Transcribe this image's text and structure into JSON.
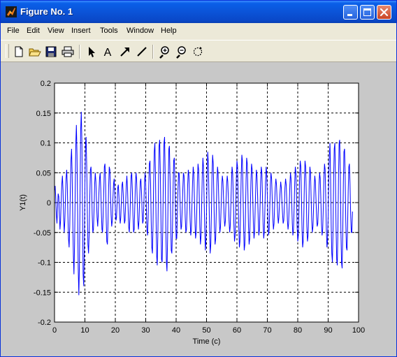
{
  "window": {
    "title": "Figure No. 1",
    "icon": "matlab-logo-icon",
    "controls": [
      "minimize-icon",
      "maximize-icon",
      "close-icon"
    ]
  },
  "menu": {
    "items": [
      "File",
      "Edit",
      "View",
      "Insert",
      "Tools",
      "Window",
      "Help"
    ]
  },
  "toolbar": {
    "tools": [
      "new-file-icon",
      "open-folder-icon",
      "save-icon",
      "print-icon",
      "select-arrow-icon",
      "insert-text-icon",
      "insert-arrow-icon",
      "insert-line-icon",
      "zoom-in-icon",
      "zoom-out-icon",
      "rotate-icon"
    ],
    "text_tool_label": "A"
  },
  "colors": {
    "titlebar": "#0a54d8",
    "figure_background": "#c8c8c8",
    "axes_background": "#ffffff",
    "series": "#0000ff"
  },
  "chart_data": {
    "type": "line",
    "xlabel": "Time (c)",
    "ylabel": "Y1(t)",
    "xlim": [
      0,
      100
    ],
    "ylim": [
      -0.2,
      0.2
    ],
    "xticks": [
      "0",
      "10",
      "20",
      "30",
      "40",
      "50",
      "60",
      "70",
      "80",
      "90",
      "100"
    ],
    "yticks": [
      "0.2",
      "0.15",
      "0.1",
      "0.05",
      "0",
      "-0.05",
      "-0.1",
      "-0.15",
      "-0.2"
    ],
    "grid": "dashed",
    "series": [
      {
        "color": "#0000ff",
        "sample_interval": 0.2,
        "x_start": 0,
        "values": [
          0.02,
          0.028,
          0.01,
          -0.02,
          -0.035,
          -0.01,
          0.015,
          0.01,
          -0.02,
          -0.045,
          -0.03,
          0.005,
          0.03,
          0.045,
          0.02,
          -0.025,
          -0.05,
          -0.03,
          0.01,
          0.04,
          0.055,
          0.03,
          -0.02,
          -0.06,
          -0.075,
          -0.04,
          0.02,
          0.07,
          0.09,
          0.05,
          -0.03,
          -0.09,
          -0.12,
          -0.07,
          0.02,
          0.1,
          0.13,
          0.08,
          -0.02,
          -0.11,
          -0.155,
          -0.1,
          0.01,
          0.12,
          0.152,
          0.1,
          -0.01,
          -0.12,
          -0.14,
          -0.08,
          0.03,
          0.1,
          0.11,
          0.06,
          -0.02,
          -0.07,
          -0.085,
          -0.05,
          0.01,
          0.055,
          0.06,
          0.03,
          -0.02,
          -0.05,
          -0.045,
          -0.01,
          0.03,
          0.05,
          0.035,
          0.005,
          -0.025,
          -0.04,
          -0.02,
          0.015,
          0.04,
          0.05,
          0.025,
          -0.015,
          -0.045,
          -0.05,
          -0.02,
          0.02,
          0.06,
          0.065,
          0.03,
          -0.025,
          -0.065,
          -0.07,
          -0.03,
          0.025,
          0.06,
          0.055,
          0.02,
          -0.02,
          -0.04,
          -0.03,
          0.005,
          0.03,
          0.04,
          0.02,
          -0.01,
          -0.03,
          -0.025,
          0.0,
          0.025,
          0.03,
          0.01,
          -0.02,
          -0.035,
          -0.025,
          0.005,
          0.03,
          0.035,
          0.015,
          -0.015,
          -0.035,
          -0.03,
          0.0,
          0.03,
          0.045,
          0.025,
          -0.01,
          -0.04,
          -0.05,
          -0.025,
          0.015,
          0.045,
          0.05,
          0.02,
          -0.02,
          -0.05,
          -0.045,
          -0.01,
          0.03,
          0.05,
          0.04,
          0.005,
          -0.03,
          -0.045,
          -0.03,
          0.005,
          0.035,
          0.04,
          0.02,
          -0.015,
          -0.035,
          -0.03,
          0.0,
          0.035,
          0.05,
          0.03,
          -0.01,
          -0.045,
          -0.055,
          -0.025,
          0.025,
          0.065,
          0.07,
          0.03,
          -0.03,
          -0.075,
          -0.085,
          -0.04,
          0.03,
          0.085,
          0.1,
          0.05,
          -0.03,
          -0.09,
          -0.105,
          -0.05,
          0.03,
          0.095,
          0.105,
          0.05,
          -0.03,
          -0.095,
          -0.1,
          -0.04,
          0.04,
          0.1,
          0.11,
          0.05,
          -0.04,
          -0.1,
          -0.115,
          -0.06,
          0.03,
          0.09,
          0.095,
          0.04,
          -0.03,
          -0.08,
          -0.085,
          -0.04,
          0.025,
          0.07,
          0.075,
          0.035,
          -0.02,
          -0.06,
          -0.06,
          -0.025,
          0.02,
          0.05,
          0.05,
          0.02,
          -0.02,
          -0.045,
          -0.04,
          -0.01,
          0.025,
          0.05,
          0.045,
          0.015,
          -0.025,
          -0.05,
          -0.045,
          -0.01,
          0.03,
          0.055,
          0.045,
          0.01,
          -0.03,
          -0.055,
          -0.045,
          -0.005,
          0.035,
          0.06,
          0.05,
          0.01,
          -0.035,
          -0.06,
          -0.05,
          -0.01,
          0.035,
          0.065,
          0.055,
          0.01,
          -0.04,
          -0.07,
          -0.055,
          -0.005,
          0.045,
          0.075,
          0.06,
          0.01,
          -0.045,
          -0.08,
          -0.065,
          -0.01,
          0.05,
          0.085,
          0.065,
          0.01,
          -0.05,
          -0.085,
          -0.07,
          -0.015,
          0.045,
          0.08,
          0.065,
          0.015,
          -0.04,
          -0.07,
          -0.06,
          -0.015,
          0.035,
          0.06,
          0.05,
          0.01,
          -0.03,
          -0.05,
          -0.04,
          -0.005,
          0.03,
          0.045,
          0.035,
          0.005,
          -0.025,
          -0.04,
          -0.03,
          0.0,
          0.03,
          0.045,
          0.035,
          0.005,
          -0.03,
          -0.05,
          -0.04,
          -0.005,
          0.035,
          0.06,
          0.05,
          0.01,
          -0.035,
          -0.065,
          -0.055,
          -0.01,
          0.04,
          0.07,
          0.06,
          0.015,
          -0.04,
          -0.075,
          -0.065,
          -0.015,
          0.045,
          0.08,
          0.07,
          0.015,
          -0.045,
          -0.08,
          -0.07,
          -0.02,
          0.04,
          0.075,
          0.065,
          0.015,
          -0.04,
          -0.07,
          -0.06,
          -0.015,
          0.035,
          0.065,
          0.055,
          0.01,
          -0.035,
          -0.06,
          -0.05,
          -0.01,
          0.03,
          0.055,
          0.045,
          0.01,
          -0.03,
          -0.055,
          -0.045,
          -0.005,
          0.035,
          0.06,
          0.05,
          0.01,
          -0.035,
          -0.06,
          -0.05,
          -0.01,
          0.035,
          0.06,
          0.05,
          0.01,
          -0.03,
          -0.055,
          -0.045,
          -0.01,
          0.03,
          0.05,
          0.04,
          0.005,
          -0.025,
          -0.045,
          -0.035,
          -0.005,
          0.025,
          0.04,
          0.03,
          0.005,
          -0.02,
          -0.035,
          -0.025,
          0.0,
          0.02,
          0.035,
          0.025,
          0.0,
          -0.02,
          -0.035,
          -0.03,
          -0.005,
          0.025,
          0.04,
          0.03,
          0.005,
          -0.03,
          -0.045,
          -0.035,
          -0.005,
          0.03,
          0.05,
          0.04,
          0.005,
          -0.035,
          -0.055,
          -0.045,
          -0.01,
          0.035,
          0.06,
          0.05,
          0.01,
          -0.04,
          -0.065,
          -0.055,
          -0.015,
          0.04,
          0.07,
          0.06,
          0.015,
          -0.045,
          -0.075,
          -0.065,
          -0.02,
          0.04,
          0.07,
          0.06,
          0.015,
          -0.04,
          -0.065,
          -0.055,
          -0.015,
          0.035,
          0.06,
          0.05,
          0.01,
          -0.03,
          -0.05,
          -0.04,
          -0.01,
          0.025,
          0.045,
          0.035,
          0.005,
          -0.025,
          -0.04,
          -0.035,
          -0.005,
          0.03,
          0.05,
          0.04,
          0.005,
          -0.035,
          -0.055,
          -0.045,
          -0.01,
          0.04,
          0.065,
          0.055,
          0.01,
          -0.045,
          -0.075,
          -0.065,
          -0.02,
          0.045,
          0.08,
          0.1,
          0.04,
          -0.04,
          -0.085,
          -0.1,
          -0.045,
          0.04,
          0.09,
          0.1,
          0.045,
          -0.04,
          -0.095,
          -0.105,
          -0.05,
          0.04,
          0.1,
          0.105,
          0.05,
          -0.05,
          -0.1,
          -0.11,
          -0.05,
          0.035,
          0.085,
          0.09,
          0.04,
          -0.03,
          -0.075,
          -0.08,
          -0.04,
          0.02,
          0.06,
          0.065,
          0.03,
          -0.02,
          -0.05,
          -0.05,
          -0.015
        ]
      }
    ]
  }
}
